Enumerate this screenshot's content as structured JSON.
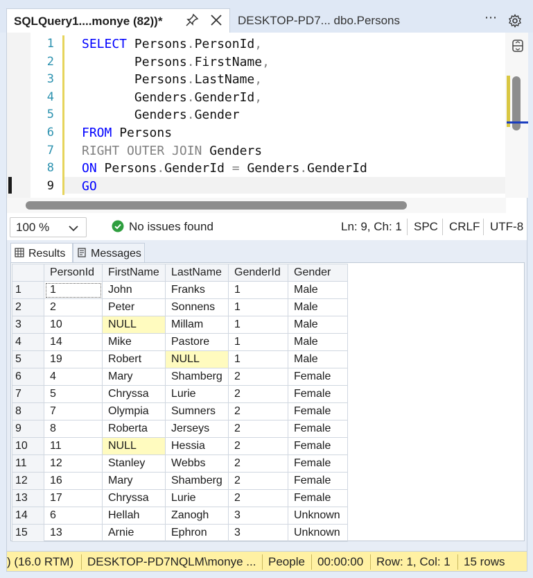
{
  "tabs": {
    "active_title": "SQLQuery1....monye (82))*",
    "inactive_title": "DESKTOP-PD7... dbo.Persons",
    "more_label": "⋯"
  },
  "editor": {
    "line_numbers": [
      "1",
      "2",
      "3",
      "4",
      "5",
      "6",
      "7",
      "8",
      "9"
    ],
    "code": {
      "l1_kw": "SELECT",
      "l1_t1": "Persons",
      "l1_t2": "PersonId",
      "l2_t1": "Persons",
      "l2_t2": "FirstName",
      "l3_t1": "Persons",
      "l3_t2": "LastName",
      "l4_t1": "Genders",
      "l4_t2": "GenderId",
      "l5_t1": "Genders",
      "l5_t2": "Gender",
      "l6_kw": "FROM",
      "l6_t": "Persons",
      "l7_kw": "RIGHT OUTER JOIN",
      "l7_t": "Genders",
      "l8_kw": "ON",
      "l8_t1": "Persons",
      "l8_t2": "GenderId",
      "l8_t3": "Genders",
      "l8_t4": "GenderId",
      "l9_kw": "GO",
      "dot": ".",
      "comma": ",",
      "eq": "="
    }
  },
  "infobar": {
    "zoom": "100 %",
    "issues": "No issues found",
    "position": "Ln: 9, Ch: 1",
    "whitespace": "SPC",
    "line_ending": "CRLF",
    "encoding": "UTF-8"
  },
  "results": {
    "tab_results": "Results",
    "tab_messages": "Messages",
    "columns": [
      "PersonId",
      "FirstName",
      "LastName",
      "GenderId",
      "Gender"
    ],
    "rows": [
      [
        "1",
        "1",
        "John",
        "Franks",
        "1",
        "Male"
      ],
      [
        "2",
        "2",
        "Peter",
        "Sonnens",
        "1",
        "Male"
      ],
      [
        "3",
        "10",
        "NULL",
        "Millam",
        "1",
        "Male"
      ],
      [
        "4",
        "14",
        "Mike",
        "Pastore",
        "1",
        "Male"
      ],
      [
        "5",
        "19",
        "Robert",
        "NULL",
        "1",
        "Male"
      ],
      [
        "6",
        "4",
        "Mary",
        "Shamberg",
        "2",
        "Female"
      ],
      [
        "7",
        "5",
        "Chryssa",
        "Lurie",
        "2",
        "Female"
      ],
      [
        "8",
        "7",
        "Olympia",
        "Sumners",
        "2",
        "Female"
      ],
      [
        "9",
        "8",
        "Roberta",
        "Jerseys",
        "2",
        "Female"
      ],
      [
        "10",
        "11",
        "NULL",
        "Hessia",
        "2",
        "Female"
      ],
      [
        "11",
        "12",
        "Stanley",
        "Webbs",
        "2",
        "Female"
      ],
      [
        "12",
        "16",
        "Mary",
        "Shamberg",
        "2",
        "Female"
      ],
      [
        "13",
        "17",
        "Chryssa",
        "Lurie",
        "2",
        "Female"
      ],
      [
        "14",
        "6",
        "Hellah",
        "Zanogh",
        "3",
        "Unknown"
      ],
      [
        "15",
        "13",
        "Arnie",
        "Ephron",
        "3",
        "Unknown"
      ]
    ]
  },
  "statusbar": {
    "version": ") (16.0 RTM)",
    "user": "DESKTOP-PD7NQLM\\monye ...",
    "database": "People",
    "elapsed": "00:00:00",
    "rowcol": "Row: 1, Col: 1",
    "rowcount": "15 rows"
  },
  "colors": {
    "keyword": "#0000ff",
    "operator": "#808080",
    "null_cell": "#fffbbf",
    "status_bar": "#fff1a3",
    "line_number": "#2b91af",
    "ok_green": "#2e9e3e"
  },
  "icons": [
    "pin-icon",
    "close-icon",
    "more-icon",
    "gear-icon",
    "split-icon",
    "chevron-down-icon",
    "check-circle-icon",
    "grid-icon",
    "messages-icon"
  ]
}
